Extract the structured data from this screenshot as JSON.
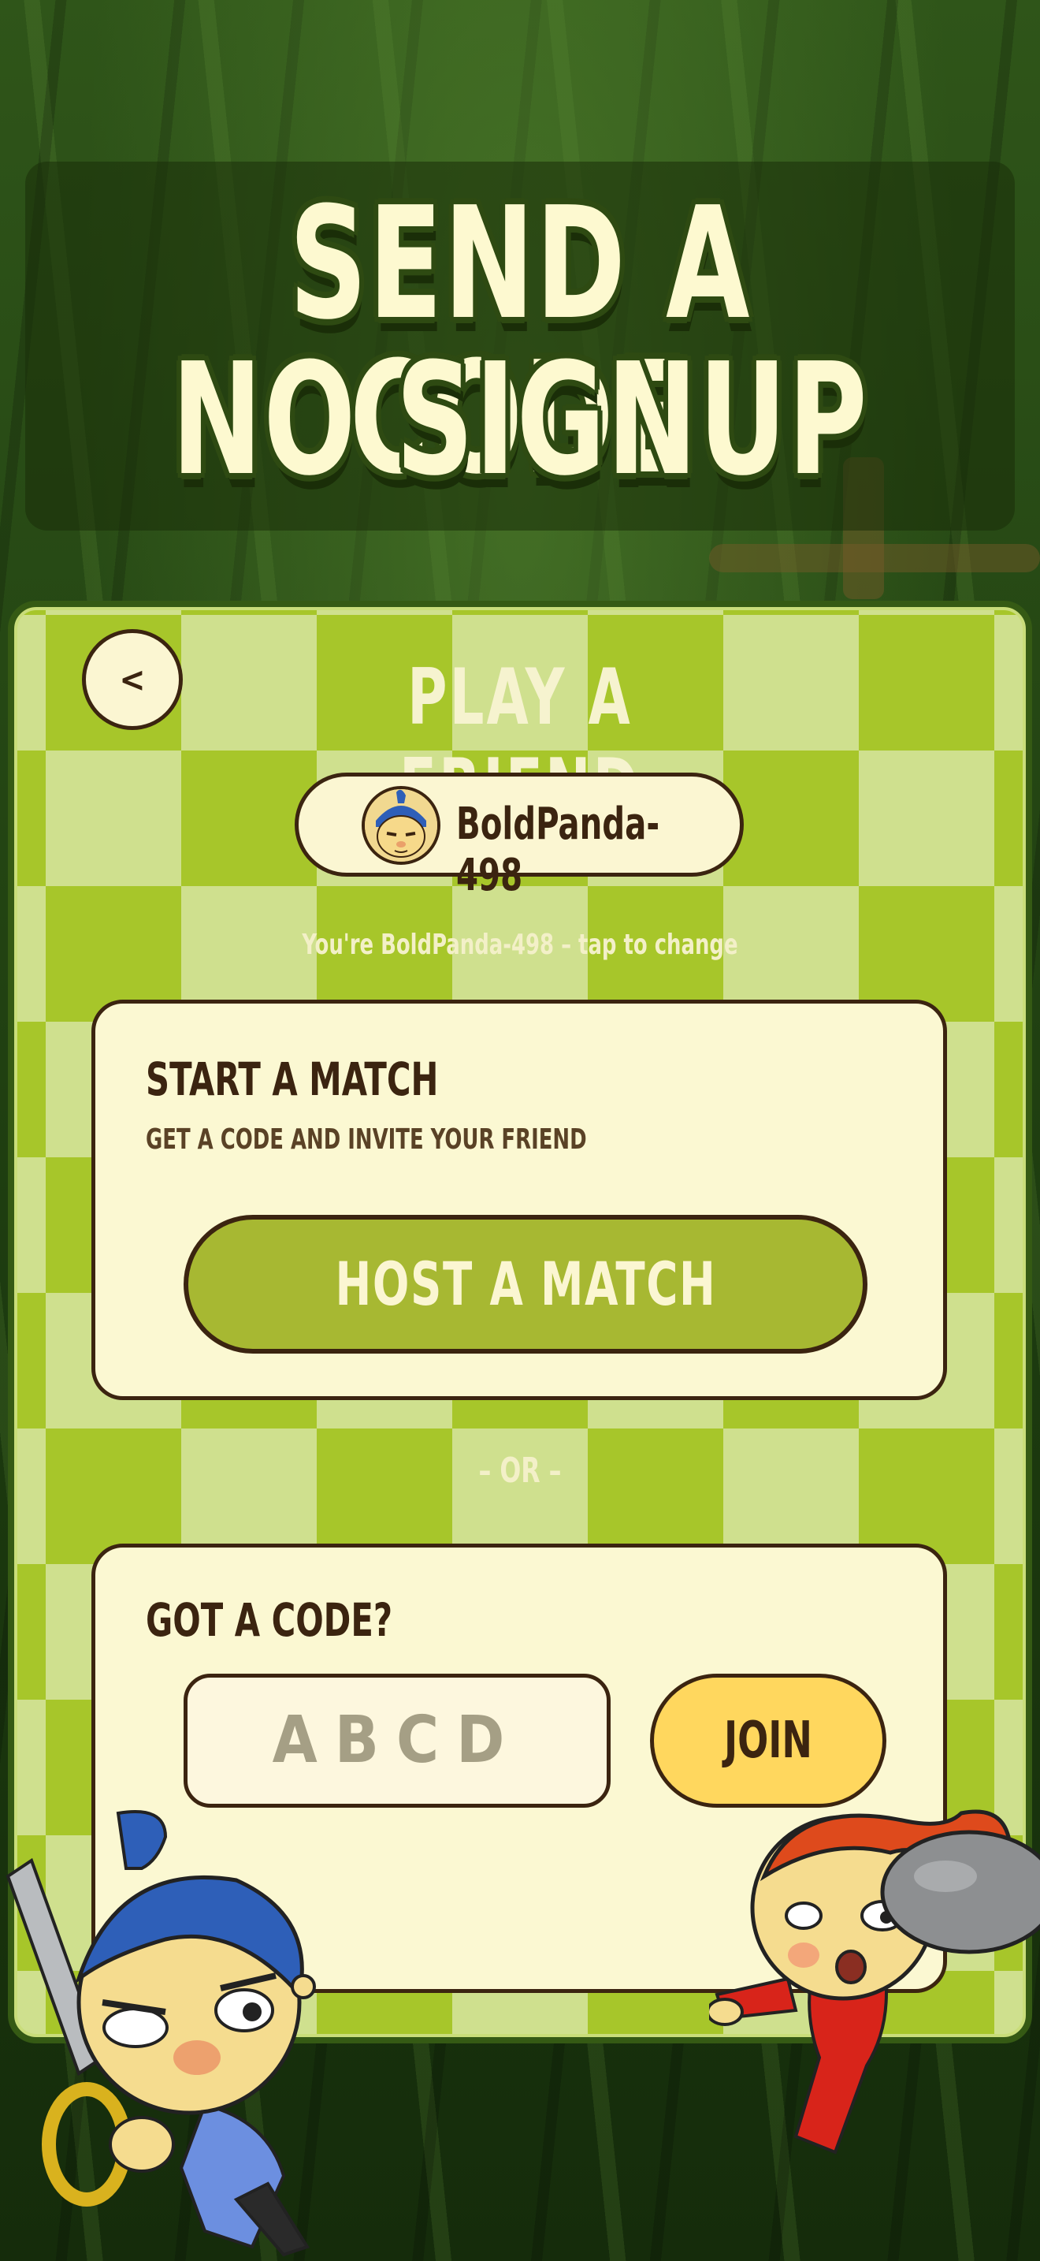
{
  "hero": {
    "line1": "SEND A CODE",
    "line2": "NO SIGNUP"
  },
  "screen": {
    "back_label": "<",
    "title": "PLAY A FRIEND",
    "player_name": "BoldPanda-498",
    "name_hint": "You're BoldPanda-498 – tap to change"
  },
  "host_panel": {
    "title": "START A MATCH",
    "subtitle": "GET A CODE AND INVITE YOUR FRIEND",
    "button_label": "HOST A MATCH"
  },
  "divider": "– OR –",
  "join_panel": {
    "title": "GOT A CODE?",
    "code_placeholder": "ABCD",
    "join_label": "JOIN"
  },
  "icons": {
    "back": "chevron-left-icon",
    "avatar": "panda-ninja-avatar",
    "left_character": "blue-ninja-with-scissors",
    "right_character": "red-ninja-with-rock"
  },
  "colors": {
    "board_dark": "#a7c62a",
    "board_light": "#cfe08e",
    "panel": "#fbf8d2",
    "outline": "#3b2410",
    "host_button": "#a7b832",
    "join_button": "#ffd75e",
    "hero_text": "#fdf9d0"
  }
}
